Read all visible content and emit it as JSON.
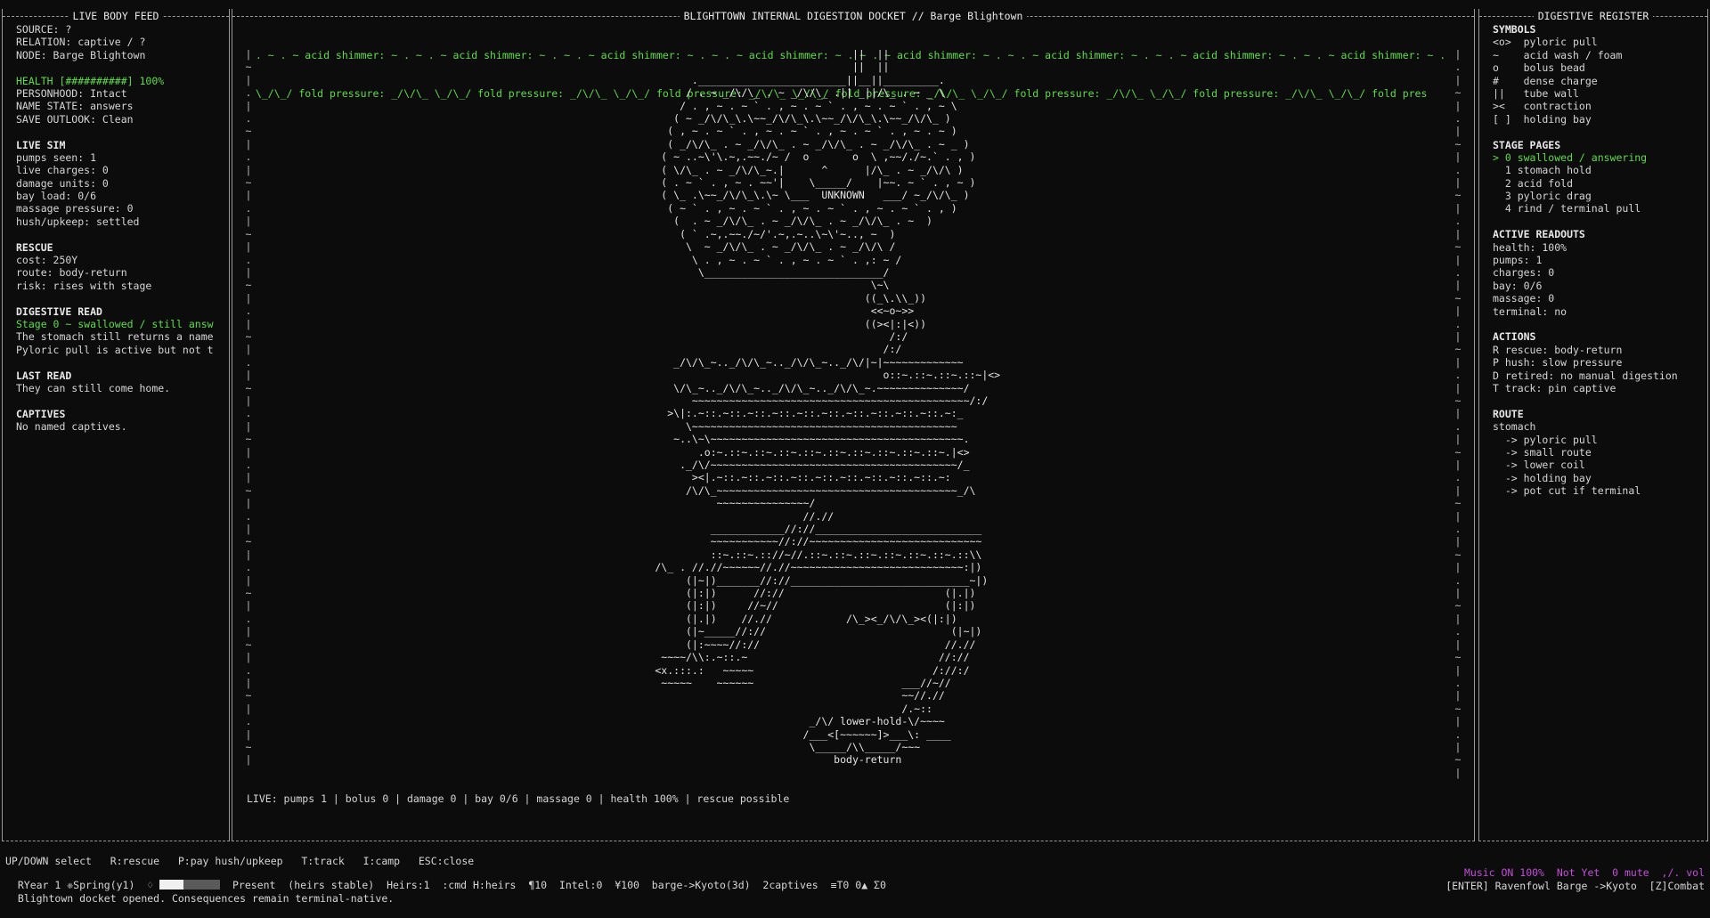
{
  "left_panel": {
    "title": "LIVE BODY FEED",
    "identity": [
      "SOURCE: ?",
      "RELATION: captive / ?",
      "NODE: Barge Blightown"
    ],
    "health": "HEALTH [##########] 100%",
    "status": [
      "PERSONHOOD: Intact",
      "NAME STATE: answers",
      "SAVE OUTLOOK: Clean"
    ],
    "live_sim": {
      "heading": "LIVE SIM",
      "lines": [
        "pumps seen: 1",
        "live charges: 0",
        "damage units: 0",
        "bay load: 0/6",
        "massage pressure: 0",
        "hush/upkeep: settled"
      ]
    },
    "rescue": {
      "heading": "RESCUE",
      "lines": [
        "cost: 250Y",
        "route: body-return",
        "risk: rises with stage"
      ]
    },
    "digestive_read": {
      "heading": "DIGESTIVE READ",
      "stage": "Stage 0 ~ swallowed / still answ",
      "lines": [
        "The stomach still returns a name",
        "Pyloric pull is active but not t"
      ]
    },
    "last_read": {
      "heading": "LAST READ",
      "line": "They can still come home."
    },
    "captives": {
      "heading": "CAPTIVES",
      "line": "No named captives."
    }
  },
  "center_panel": {
    "title": "BLIGHTTOWN INTERNAL DIGESTION DOCKET // Barge Blightown",
    "texture_line_1": " . ~ . ~ acid shimmer: ~ . ~ . ~ acid shimmer: ~ . ~ . ~ acid shimmer: ~ . ~ . ~ acid shimmer: ~ . ~ . ~ acid shimmer: ~ . ~ . ~ acid shimmer: ~ . ~ . ~ acid shimmer: ~ . ~ . ~ acid shimmer: ~ .",
    "texture_line_2": " \\_/\\_/ fold pressure: _/\\/\\_ \\_/\\_/ fold pressure: _/\\/\\_ \\_/\\_/ fold pressure: _/\\/\\_ \\_/\\_/ fold pressure: _/\\/\\_ \\_/\\_/ fold pressure: _/\\/\\_ \\_/\\_/ fold pressure: _/\\/\\_ \\_/\\_/ fold pres",
    "rail_left": "|\n~\n|\n.\n|\n.\n~\n|\n.\n|\n~\n|\n.\n|\n~\n|\n.\n|\n~\n|\n.\n|\n~\n|\n.\n|\n~\n|\n.\n|\n~\n|\n.\n|\n~\n|\n.\n|\n~\n|\n.\n|\n~\n|\n.\n|\n~\n|\n.\n|\n~\n|\n.\n|\n~\n|",
    "rail_right": "|\n.\n|\n~\n|\n.\n|\n~\n|\n.\n|\n~\n|\n.\n|\n~\n|\n.\n|\n~\n|\n.\n|\n~\n|\n.\n|\n~\n|\n.\n|\n~\n|\n.\n|\n~\n|\n.\n|\n~\n|\n.\n|\n~\n|\n.\n|\n~\n|\n.\n|\n~\n|\n.\n|\n~\n|",
    "figure_label": "UNKNOWN",
    "art": "                                        ||  ||\n                                        ||  ||\n              .________________________||__||_________.\n             / . ~ _/\\/\\_ . ~ _/\\/\\_ .|| _||/\\_ . ~ _ \\\n            / . , ~ . ~ ` . , ~ . ~ ` . , ~ . ~ ` . , ~ \\\n           ( ~ _/\\/\\_\\.\\~~_/\\/\\_\\.\\~~_/\\/\\_\\.\\~~_/\\/\\_ )\n          ( , ~ . ~ ` . , ~ . ~ ` . , ~ . ~ ` . , ~ . ~ )\n          ( _/\\/\\_ . ~ _/\\/\\_ . ~ _/\\/\\_ . ~ _/\\/\\_ . ~ _ )\n         ( ~ ..~\\'\\.~,.~~./~ /  o       o  \\ ,~~/./~.` . , )\n         ( \\/\\_ . ~ _/\\/\\_~.|      ^      |/\\_ . ~ _/\\/\\ )\n         ( . ~ ` . , ~ . ~~'|    \\_____/    |~~. ~ ` . , ~ )\n         ( \\_ .\\~~_/\\/\\_\\.\\~ \\___  UNKNOWN   ___/ ~_/\\/\\_ )\n          ( ~ ` . , ~ . ~ ` . , ~ . ~ ` . , ~ . ~ ` . , )\n           (  . ~ _/\\/\\_ . ~ _/\\/\\_ . ~ _/\\/\\_ . ~  )\n            ( ` .~,.~~./~/'.~,.~..\\~\\'~.., ~  )\n             \\  ~ _/\\/\\_ . ~ _/\\/\\_ . ~ _/\\/\\ /\n              \\ . , ~ . ~ ` . , ~ . ~ ` . ,: ~ /\n               \\_____________________________/\n                                           \\~\\\n                                          ((_\\.\\\\_))\n                                           <<~o~>>\n                                          ((><|:|<))\n                                              /:/\n                                             /:/\n           _/\\/\\_~.._/\\/\\_~.._/\\/\\_~.._/\\/|~|~~~~~~~~~~~~~\n                                             o::~.::~.::~.::~|<>\n           \\/\\_~.._/\\/\\_~.._/\\/\\_~.._/\\/\\_~.~~~~~~~~~~~~~~/\n              ~~~~~~~~~~~~~~~~~~~~~~~~~~~~~~~~~~~~~~~~~~~~~/:/\n          >\\|:.~::.~::.~::.~::.~::.~::.~::.~::.~::.~::.~:_\n             \\~~~~~~~~~~~~~~~~~~~~~~~~~~~~~~~~~~~~~~~~~~~\n           ~..\\~\\~~~~~~~~~~~~~~~~~~~~~~~~~~~~~~~~~~~~~~~~~.\n               .o:~.::~.::~.::~.::~.::~.::~.::~.::~.::~.|<>\n            ._/\\/~~~~~~~~~~~~~~~~~~~~~~~~~~~~~~~~~~~~~~~~/_\n              ><|.~::.~::.~::.~::.~::.~::.~::.~::.~::.~:\n             /\\/\\_~~~~~~~~~~~~~~~~~~~~~~~~~~~~~~~~~~~~~~~_/\\\n                  ~~~~~~~~~~~~~~~/\n                                //.//\n                 ____________//://___________________________\n                 ~~~~~~~~~~~//://~~~~~~~~~~~~~~~~~~~~~~~~~~~~\n                 ::~.::~.:://~//.::~.::~.::~.::~.::~.::~.::\\\\\n        /\\_ . //.//~~~~~~//.//~~~~~~~~~~~~~~~~~~~~~~~~~~~~:|)\n             (|~|)_______//://_____________________________~|)\n             (|:|)      //://                          (|.|)\n             (|:|)     //~//                           (|:|)\n             (|.|)    //.//            /\\_><_/\\/\\_><(|:|)\n             (|~_____//://                              (|~|)\n             (|:~~~~//://                              //.//\n         ~~~~/\\\\:.~::.~                               //://\n        <x.:::.:   ~~~~~                             /://:/\n         ~~~~~    ~~~~~~                        ___//~//\n                                                ~~//.//\n                                                /.~::\n                                 _/\\/ lower-hold-\\/~~~~\n                                /___<[~~~~~~]>___\\: ____\n                                 \\_____/\\\\_____/~~~\n                                     body-return",
    "status_line": "LIVE: pumps 1 | bolus 0 | damage 0 | bay 0/6 | massage 0 | health 100% | rescue possible"
  },
  "right_panel": {
    "title": "DIGESTIVE REGISTER",
    "symbols": {
      "heading": "SYMBOLS",
      "lines": [
        "<o>  pyloric pull",
        "~    acid wash / foam",
        "o    bolus bead",
        "#    dense charge",
        "||   tube wall",
        "><   contraction",
        "[ ]  holding bay"
      ]
    },
    "stage_pages": {
      "heading": "STAGE PAGES",
      "active": "> 0 swallowed / answering",
      "lines": [
        "  1 stomach hold",
        "  2 acid fold",
        "  3 pyloric drag",
        "  4 rind / terminal pull"
      ]
    },
    "active_readouts": {
      "heading": "ACTIVE READOUTS",
      "lines": [
        "health: 100%",
        "pumps: 1",
        "charges: 0",
        "bay: 0/6",
        "massage: 0",
        "terminal: no"
      ]
    },
    "actions": {
      "heading": "ACTIONS",
      "lines": [
        "R rescue: body-return",
        "P hush: slow pressure",
        "D retired: no manual digestion",
        "T track: pin captive"
      ]
    },
    "route": {
      "heading": "ROUTE",
      "lines": [
        "stomach",
        "  -> pyloric pull",
        "  -> small route",
        "  -> lower coil",
        "  -> holding bay",
        "  -> pot cut if terminal"
      ]
    }
  },
  "footer": {
    "keys": "UP/DOWN select   R:rescue   P:pay hush/upkeep   T:track   I:camp   ESC:close",
    "status_left": "RYear 1 ❈Spring(y1)  ♢",
    "status_mid": "Present  (heirs stable)  Heirs:1  :cmd H:heirs  ¶10  Intel:0  ¥100  barge->Kyoto(3d)  2captives  ≡T0 0▲ Σ0",
    "progress_fraction": 0.4,
    "music": "Music ON 100%  Not Yet  0 mute  ,/. vol",
    "message": "Blightown docket opened. Consequences remain terminal-native.",
    "hint": "[ENTER] Ravenfowl Barge ->Kyoto  [Z]Combat",
    "accent_green": "#5fdc4a",
    "accent_purple": "#c04fd8"
  }
}
